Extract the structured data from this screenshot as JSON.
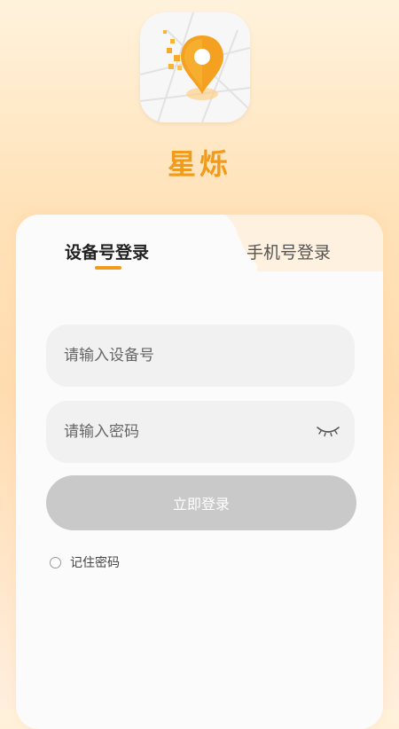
{
  "app": {
    "name": "星烁"
  },
  "tabs": [
    {
      "label": "设备号登录",
      "active": true
    },
    {
      "label": "手机号登录",
      "active": false
    }
  ],
  "form": {
    "device_placeholder": "请输入设备号",
    "device_value": "",
    "password_placeholder": "请输入密码",
    "password_value": "",
    "login_label": "立即登录",
    "remember_label": "记住密码",
    "remember_checked": false
  },
  "colors": {
    "accent": "#f29a1a",
    "button_disabled": "#c9c9c9",
    "background_top": "#fff2dc"
  },
  "icons": {
    "logo": "map-pin-icon",
    "password_toggle": "eye-closed-icon"
  }
}
